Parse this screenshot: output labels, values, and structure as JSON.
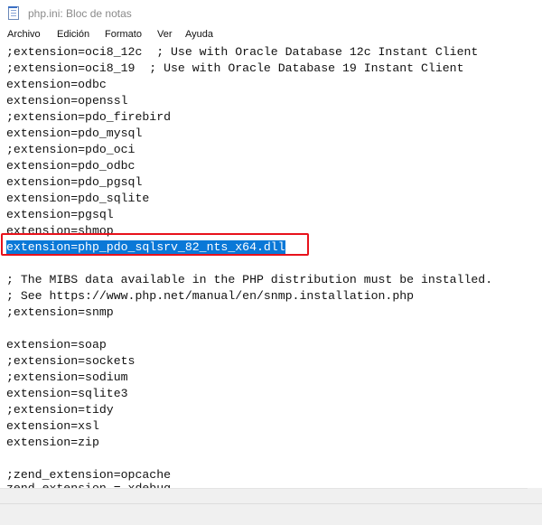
{
  "window": {
    "title": "php.ini: Bloc de notas"
  },
  "menu": [
    "Archivo",
    "Edición",
    "Formato",
    "Ver",
    "Ayuda"
  ],
  "editor": {
    "lines": [
      ";extension=oci8_12c  ; Use with Oracle Database 12c Instant Client",
      ";extension=oci8_19  ; Use with Oracle Database 19 Instant Client",
      "extension=odbc",
      "extension=openssl",
      ";extension=pdo_firebird",
      "extension=pdo_mysql",
      ";extension=pdo_oci",
      "extension=pdo_odbc",
      "extension=pdo_pgsql",
      "extension=pdo_sqlite",
      "extension=pgsql",
      "extension=shmop",
      "extension=php_pdo_sqlsrv_82_nts_x64.dll",
      "",
      "; The MIBS data available in the PHP distribution must be installed.",
      "; See https://www.php.net/manual/en/snmp.installation.php",
      ";extension=snmp",
      "",
      "extension=soap",
      ";extension=sockets",
      ";extension=sodium",
      "extension=sqlite3",
      ";extension=tidy",
      "extension=xsl",
      "extension=zip",
      "",
      ";zend_extension=opcache",
      "zend_extension = xdebug"
    ],
    "selected_line": 12
  }
}
